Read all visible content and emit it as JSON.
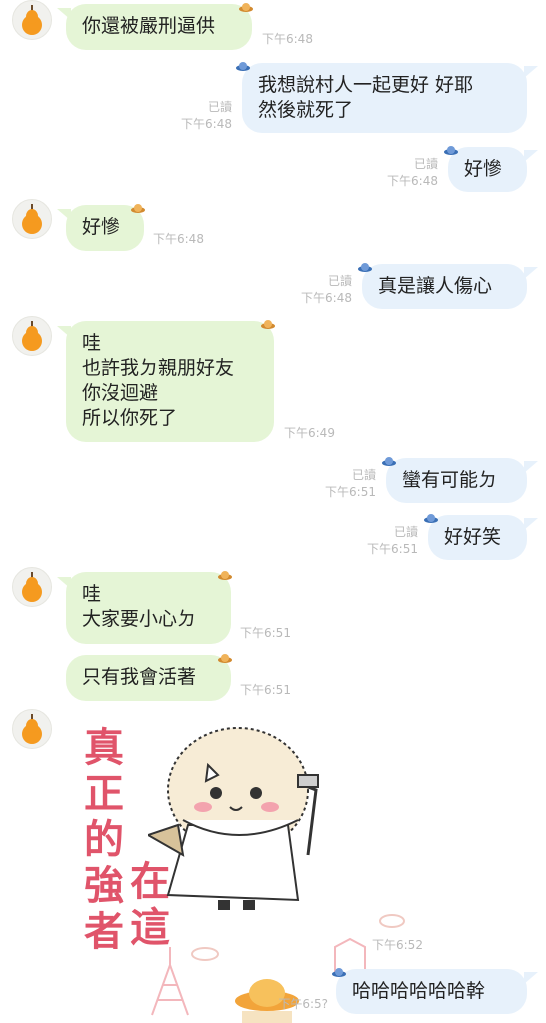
{
  "messages": [
    {
      "text": "你還被嚴刑逼供",
      "time": "下午6:48"
    },
    {
      "text": "我想說村人一起更好 好耶\n然後就死了",
      "read": "已讀",
      "time": "下午6:48"
    },
    {
      "text": "好慘",
      "read": "已讀",
      "time": "下午6:48"
    },
    {
      "text": "好慘",
      "time": "下午6:48"
    },
    {
      "text": "真是讓人傷心",
      "read": "已讀",
      "time": "下午6:48"
    },
    {
      "text": "哇\n也許我ㄉ親朋好友\n你沒迴避\n所以你死了",
      "time": "下午6:49"
    },
    {
      "text": "蠻有可能ㄉ",
      "read": "已讀",
      "time": "下午6:51"
    },
    {
      "text": "好好笑",
      "read": "已讀",
      "time": "下午6:51"
    },
    {
      "text": "哇\n大家要小心ㄉ",
      "time": "下午6:51"
    },
    {
      "text": "只有我會活著",
      "time": "下午6:51"
    },
    {
      "time": "下午6:52"
    },
    {
      "text": "哈哈哈哈哈哈幹",
      "time": "下午6:5?"
    }
  ],
  "sticker": {
    "caption_left": "真正的強者",
    "caption_right": "在這"
  },
  "colors": {
    "incoming": "#e5f5d6",
    "outgoing": "#e7f1fb",
    "sticker_text": "#e0546a",
    "meta": "#b9b9b9"
  }
}
